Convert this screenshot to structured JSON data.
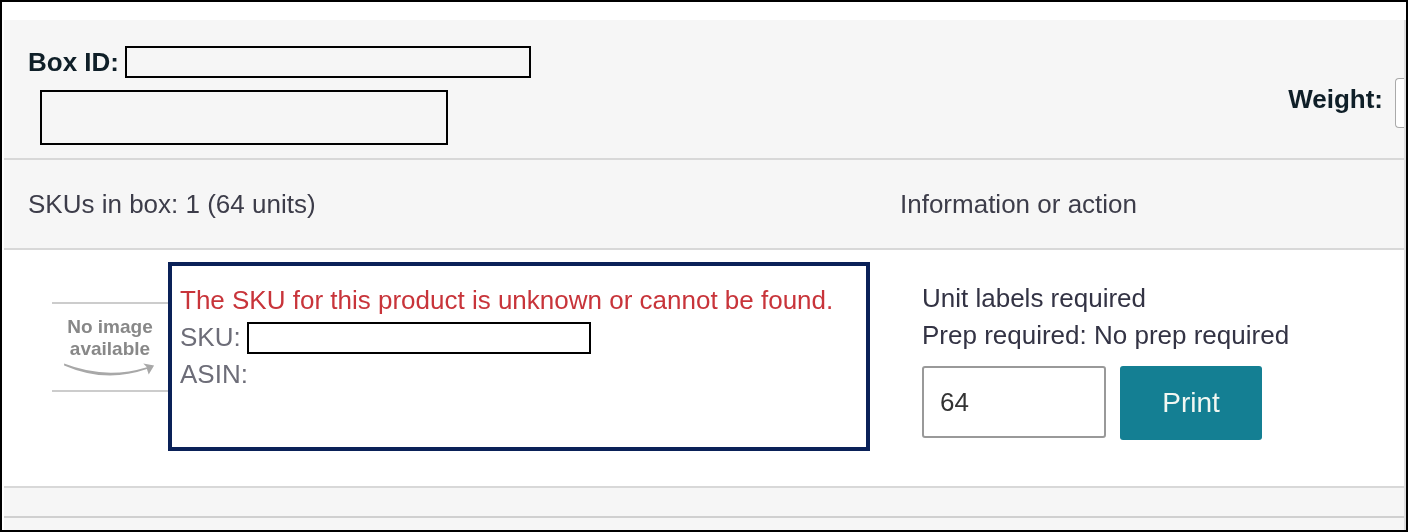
{
  "header": {
    "box_id_label": "Box ID:",
    "weight_label": "Weight:"
  },
  "columns": [
    "SKUs in box: 1 (64 units)",
    "Information or action"
  ],
  "item": {
    "image": {
      "kind": "no-image",
      "text": "No image available"
    },
    "error": "The SKU for this product is unknown or cannot be found.",
    "sku_label": "SKU:",
    "asin_label": "ASIN:",
    "info": [
      "Unit labels required",
      "Prep required: No prep required"
    ],
    "quantity": "64",
    "print_button": "Print"
  }
}
